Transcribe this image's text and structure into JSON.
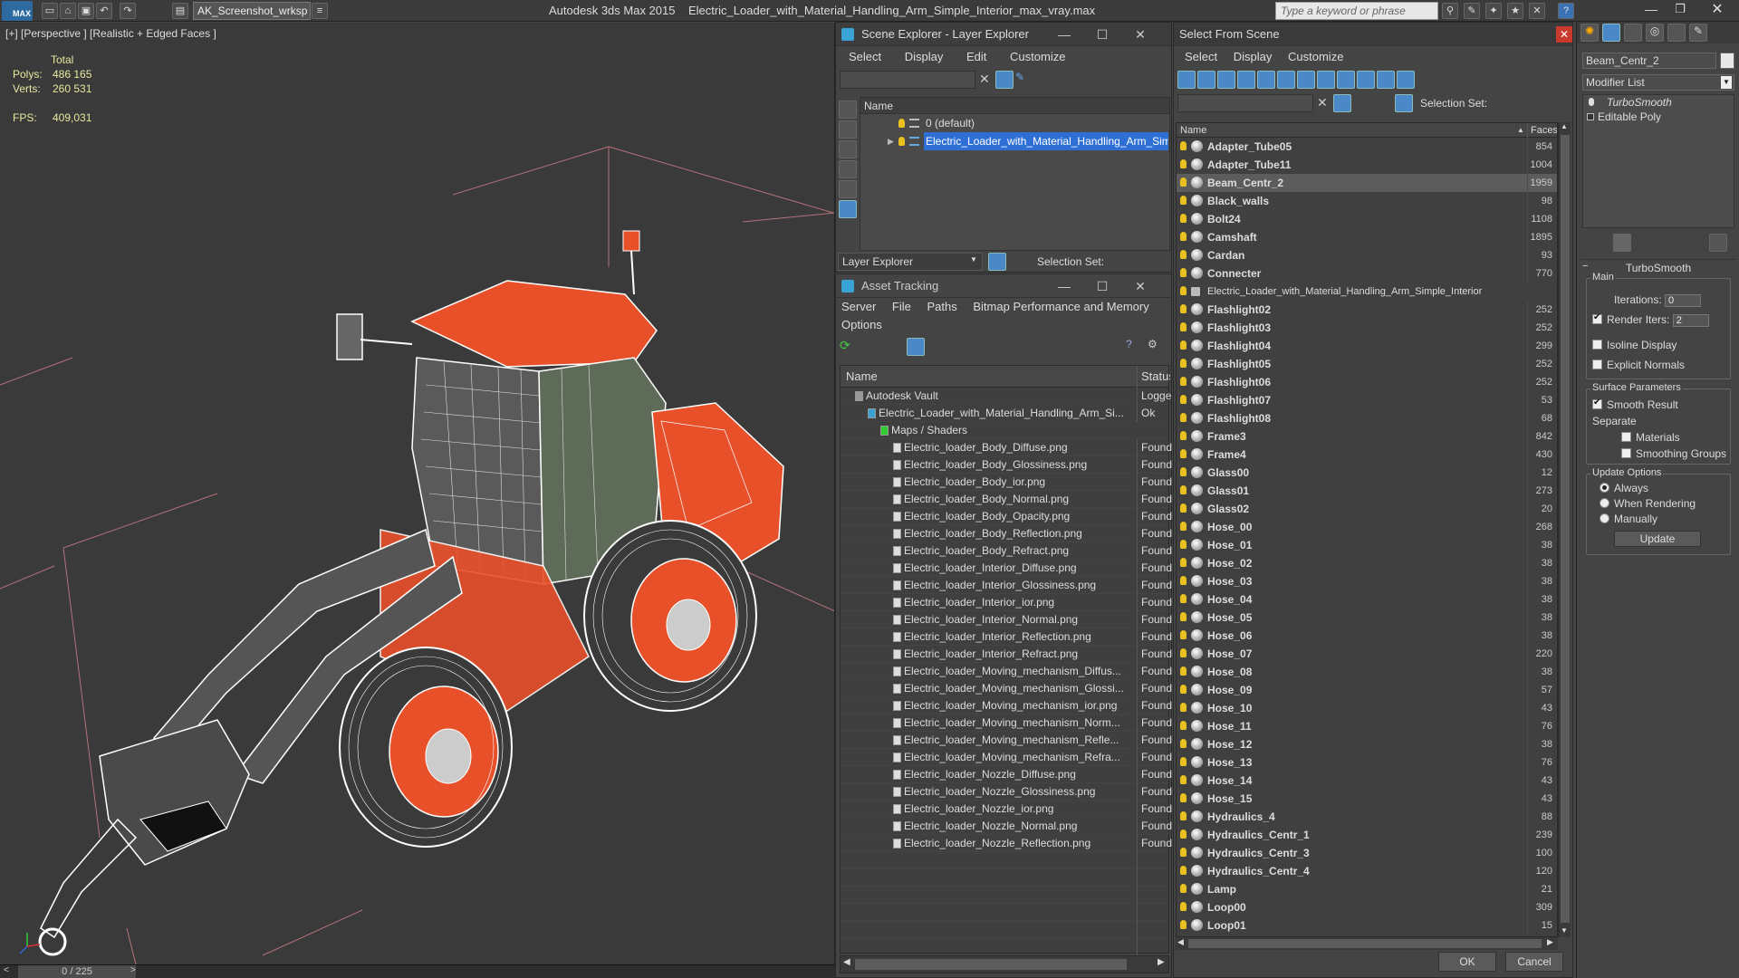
{
  "titlebar": {
    "app_logo": "MAX",
    "workspace": "AK_Screenshot_wrksp",
    "app_name": "Autodesk 3ds Max  2015",
    "file_name": "Electric_Loader_with_Material_Handling_Arm_Simple_Interior_max_vray.max",
    "search_placeholder": "Type a keyword or phrase"
  },
  "viewport": {
    "label": "[+] [Perspective ] [Realistic + Edged Faces ]",
    "stats": {
      "total_label": "Total",
      "polys_label": "Polys:",
      "polys_value": "486 165",
      "verts_label": "Verts:",
      "verts_value": "260 531",
      "fps_label": "FPS:",
      "fps_value": "409,031"
    },
    "frame_counter": "0 / 225",
    "colors": {
      "accent": "#e8502a",
      "wire": "#ffffff",
      "bg": "#3a3a3a"
    }
  },
  "scene_explorer": {
    "title": "Scene Explorer - Layer Explorer",
    "menu": [
      "Select",
      "Display",
      "Edit",
      "Customize"
    ],
    "column": "Name",
    "rows": [
      {
        "label": "0 (default)",
        "selected": false
      },
      {
        "label": "Electric_Loader_with_Material_Handling_Arm_Simple_Inte...",
        "selected": true
      }
    ],
    "explorer_dropdown": "Layer Explorer",
    "selection_set_label": "Selection Set:"
  },
  "asset_tracking": {
    "title": "Asset Tracking",
    "menu": [
      "Server",
      "File",
      "Paths",
      "Bitmap Performance and Memory"
    ],
    "menu2": "Options",
    "col_name": "Name",
    "col_status": "Status",
    "rows": [
      {
        "name": "Autodesk Vault",
        "status": "Logge",
        "indent": 1
      },
      {
        "name": "Electric_Loader_with_Material_Handling_Arm_Si...",
        "status": "Ok",
        "indent": 2
      },
      {
        "name": "Maps / Shaders",
        "status": "",
        "indent": 3
      },
      {
        "name": "Electric_loader_Body_Diffuse.png",
        "status": "Found",
        "indent": 4
      },
      {
        "name": "Electric_loader_Body_Glossiness.png",
        "status": "Found",
        "indent": 4
      },
      {
        "name": "Electric_loader_Body_ior.png",
        "status": "Found",
        "indent": 4
      },
      {
        "name": "Electric_loader_Body_Normal.png",
        "status": "Found",
        "indent": 4
      },
      {
        "name": "Electric_loader_Body_Opacity.png",
        "status": "Found",
        "indent": 4
      },
      {
        "name": "Electric_loader_Body_Reflection.png",
        "status": "Found",
        "indent": 4
      },
      {
        "name": "Electric_loader_Body_Refract.png",
        "status": "Found",
        "indent": 4
      },
      {
        "name": "Electric_loader_Interior_Diffuse.png",
        "status": "Found",
        "indent": 4
      },
      {
        "name": "Electric_loader_Interior_Glossiness.png",
        "status": "Found",
        "indent": 4
      },
      {
        "name": "Electric_loader_Interior_ior.png",
        "status": "Found",
        "indent": 4
      },
      {
        "name": "Electric_loader_Interior_Normal.png",
        "status": "Found",
        "indent": 4
      },
      {
        "name": "Electric_loader_Interior_Reflection.png",
        "status": "Found",
        "indent": 4
      },
      {
        "name": "Electric_loader_Interior_Refract.png",
        "status": "Found",
        "indent": 4
      },
      {
        "name": "Electric_loader_Moving_mechanism_Diffus...",
        "status": "Found",
        "indent": 4
      },
      {
        "name": "Electric_loader_Moving_mechanism_Glossi...",
        "status": "Found",
        "indent": 4
      },
      {
        "name": "Electric_loader_Moving_mechanism_ior.png",
        "status": "Found",
        "indent": 4
      },
      {
        "name": "Electric_loader_Moving_mechanism_Norm...",
        "status": "Found",
        "indent": 4
      },
      {
        "name": "Electric_loader_Moving_mechanism_Refle...",
        "status": "Found",
        "indent": 4
      },
      {
        "name": "Electric_loader_Moving_mechanism_Refra...",
        "status": "Found",
        "indent": 4
      },
      {
        "name": "Electric_loader_Nozzle_Diffuse.png",
        "status": "Found",
        "indent": 4
      },
      {
        "name": "Electric_loader_Nozzle_Glossiness.png",
        "status": "Found",
        "indent": 4
      },
      {
        "name": "Electric_loader_Nozzle_ior.png",
        "status": "Found",
        "indent": 4
      },
      {
        "name": "Electric_loader_Nozzle_Normal.png",
        "status": "Found",
        "indent": 4
      },
      {
        "name": "Electric_loader_Nozzle_Reflection.png",
        "status": "Found",
        "indent": 4
      }
    ]
  },
  "select_from_scene": {
    "title": "Select From Scene",
    "menu": [
      "Select",
      "Display",
      "Customize"
    ],
    "selection_set_label": "Selection Set:",
    "col_name": "Name",
    "col_faces": "Faces",
    "ok_label": "OK",
    "cancel_label": "Cancel",
    "rows": [
      {
        "name": "Adapter_Tube05",
        "faces": "854",
        "bold": true
      },
      {
        "name": "Adapter_Tube11",
        "faces": "1004",
        "bold": true
      },
      {
        "name": "Beam_Centr_2",
        "faces": "1959",
        "bold": true,
        "selected": true
      },
      {
        "name": "Black_walls",
        "faces": "98",
        "bold": true
      },
      {
        "name": "Bolt24",
        "faces": "1108",
        "bold": true
      },
      {
        "name": "Camshaft",
        "faces": "1895",
        "bold": true
      },
      {
        "name": "Cardan",
        "faces": "93",
        "bold": true
      },
      {
        "name": "Connecter",
        "faces": "770",
        "bold": true
      },
      {
        "name": "Electric_Loader_with_Material_Handling_Arm_Simple_Interior",
        "faces": "",
        "bold": false
      },
      {
        "name": "Flashlight02",
        "faces": "252",
        "bold": true
      },
      {
        "name": "Flashlight03",
        "faces": "252",
        "bold": true
      },
      {
        "name": "Flashlight04",
        "faces": "299",
        "bold": true
      },
      {
        "name": "Flashlight05",
        "faces": "252",
        "bold": true
      },
      {
        "name": "Flashlight06",
        "faces": "252",
        "bold": true
      },
      {
        "name": "Flashlight07",
        "faces": "53",
        "bold": true
      },
      {
        "name": "Flashlight08",
        "faces": "68",
        "bold": true
      },
      {
        "name": "Frame3",
        "faces": "842",
        "bold": true
      },
      {
        "name": "Frame4",
        "faces": "430",
        "bold": true
      },
      {
        "name": "Glass00",
        "faces": "12",
        "bold": true
      },
      {
        "name": "Glass01",
        "faces": "273",
        "bold": true
      },
      {
        "name": "Glass02",
        "faces": "20",
        "bold": true
      },
      {
        "name": "Hose_00",
        "faces": "268",
        "bold": true
      },
      {
        "name": "Hose_01",
        "faces": "38",
        "bold": true
      },
      {
        "name": "Hose_02",
        "faces": "38",
        "bold": true
      },
      {
        "name": "Hose_03",
        "faces": "38",
        "bold": true
      },
      {
        "name": "Hose_04",
        "faces": "38",
        "bold": true
      },
      {
        "name": "Hose_05",
        "faces": "38",
        "bold": true
      },
      {
        "name": "Hose_06",
        "faces": "38",
        "bold": true
      },
      {
        "name": "Hose_07",
        "faces": "220",
        "bold": true
      },
      {
        "name": "Hose_08",
        "faces": "38",
        "bold": true
      },
      {
        "name": "Hose_09",
        "faces": "57",
        "bold": true
      },
      {
        "name": "Hose_10",
        "faces": "43",
        "bold": true
      },
      {
        "name": "Hose_11",
        "faces": "76",
        "bold": true
      },
      {
        "name": "Hose_12",
        "faces": "38",
        "bold": true
      },
      {
        "name": "Hose_13",
        "faces": "76",
        "bold": true
      },
      {
        "name": "Hose_14",
        "faces": "43",
        "bold": true
      },
      {
        "name": "Hose_15",
        "faces": "43",
        "bold": true
      },
      {
        "name": "Hydraulics_4",
        "faces": "88",
        "bold": true
      },
      {
        "name": "Hydraulics_Centr_1",
        "faces": "239",
        "bold": true
      },
      {
        "name": "Hydraulics_Centr_3",
        "faces": "100",
        "bold": true
      },
      {
        "name": "Hydraulics_Centr_4",
        "faces": "120",
        "bold": true
      },
      {
        "name": "Lamp",
        "faces": "21",
        "bold": true
      },
      {
        "name": "Loop00",
        "faces": "309",
        "bold": true
      },
      {
        "name": "Loop01",
        "faces": "15",
        "bold": true
      }
    ]
  },
  "command_panel": {
    "object_name": "Beam_Centr_2",
    "modifier_list": "Modifier List",
    "stack": [
      "TurboSmooth",
      "Editable Poly"
    ],
    "rollout_title": "TurboSmooth",
    "main_label": "Main",
    "iterations_label": "Iterations:",
    "iterations_value": "0",
    "render_iters_label": "Render Iters:",
    "render_iters_value": "2",
    "isoline_label": "Isoline Display",
    "explicit_normals_label": "Explicit Normals",
    "surface_params_label": "Surface Parameters",
    "smooth_result_label": "Smooth Result",
    "separate_label": "Separate",
    "materials_label": "Materials",
    "smoothing_groups_label": "Smoothing Groups",
    "update_options_label": "Update Options",
    "always_label": "Always",
    "when_rendering_label": "When Rendering",
    "manually_label": "Manually",
    "update_button": "Update"
  }
}
